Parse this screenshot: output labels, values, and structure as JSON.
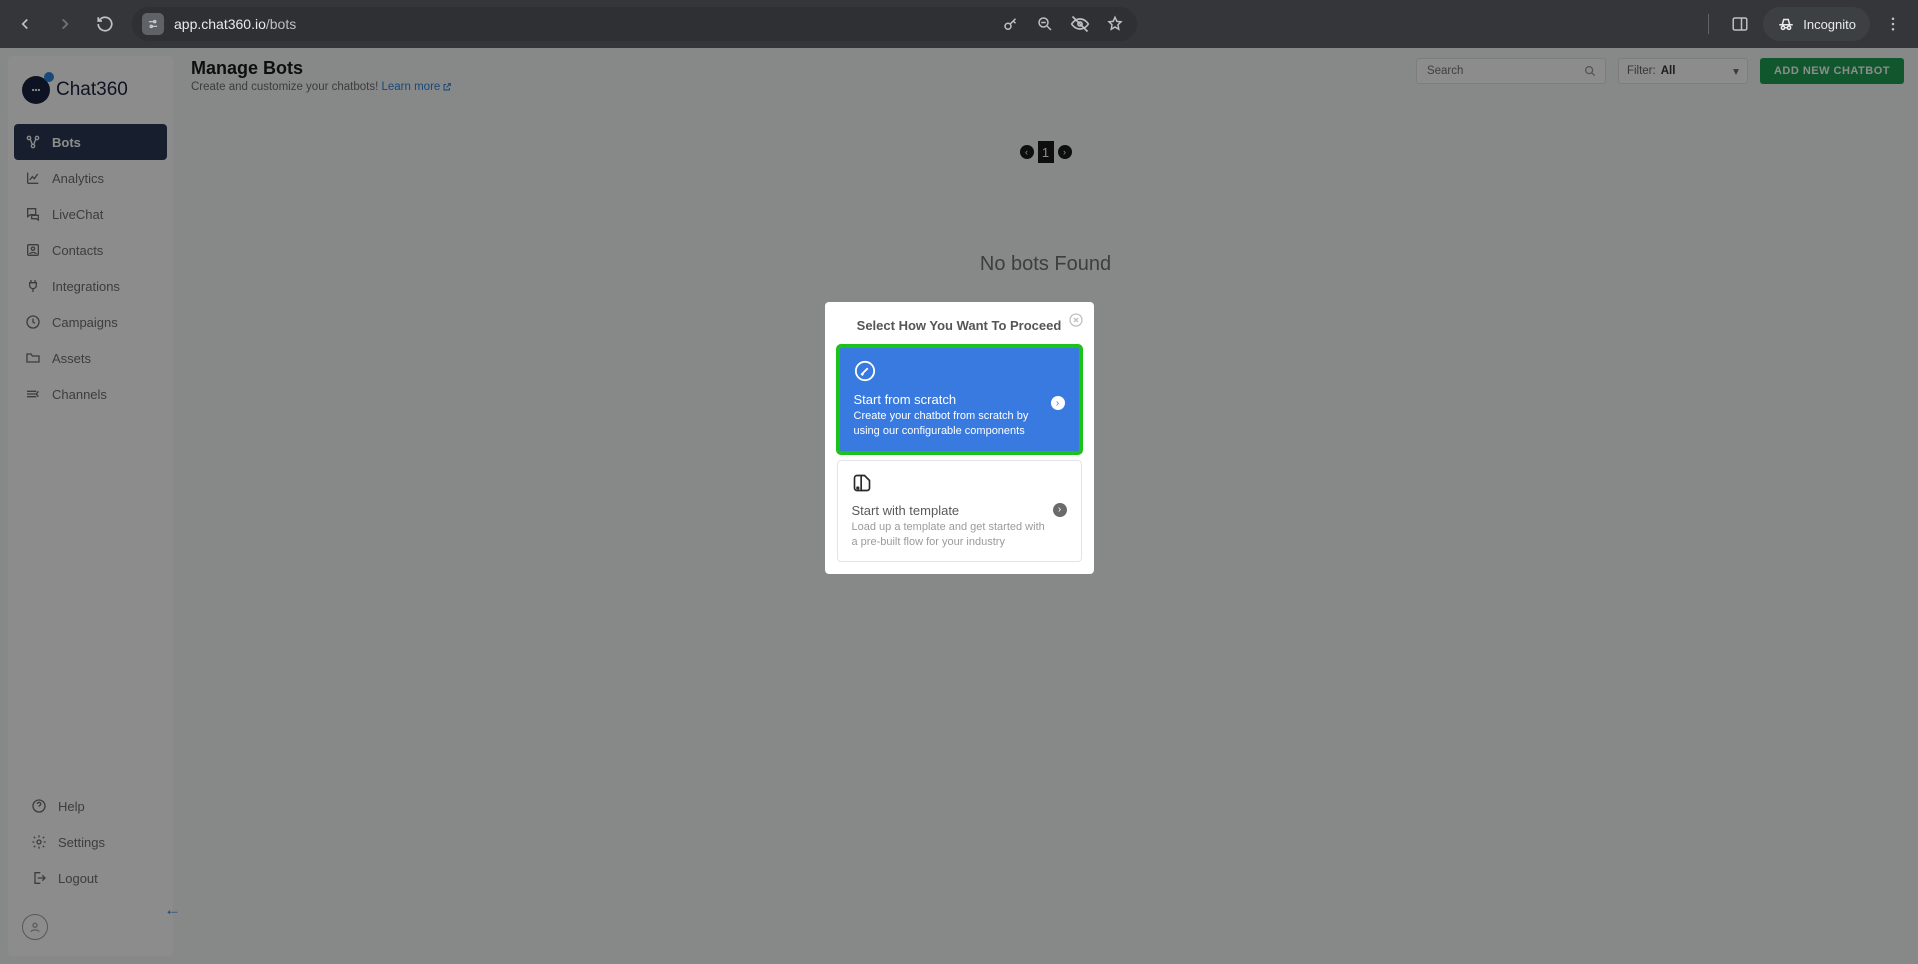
{
  "browser": {
    "url_host": "app.chat360.io",
    "url_path": "/bots",
    "incognito_label": "Incognito"
  },
  "logo_text": "Chat360",
  "sidebar": {
    "items": [
      {
        "label": "Bots",
        "icon": "bots-icon",
        "active": true
      },
      {
        "label": "Analytics",
        "icon": "chart-icon"
      },
      {
        "label": "LiveChat",
        "icon": "chat-icon"
      },
      {
        "label": "Contacts",
        "icon": "contacts-icon"
      },
      {
        "label": "Integrations",
        "icon": "plug-icon"
      },
      {
        "label": "Campaigns",
        "icon": "campaign-icon"
      },
      {
        "label": "Assets",
        "icon": "folder-icon"
      },
      {
        "label": "Channels",
        "icon": "channels-icon"
      }
    ],
    "bottom": [
      {
        "label": "Help",
        "icon": "help-icon"
      },
      {
        "label": "Settings",
        "icon": "gear-icon"
      },
      {
        "label": "Logout",
        "icon": "logout-icon"
      }
    ]
  },
  "header": {
    "title": "Manage Bots",
    "subtitle": "Create and customize your chatbots! ",
    "learn_more": "Learn more",
    "search_placeholder": "Search",
    "filter_label": "Filter:",
    "filter_value": "All",
    "add_button": "ADD NEW CHATBOT"
  },
  "pager": {
    "current": "1"
  },
  "empty_msg": "No bots Found",
  "modal": {
    "title": "Select How You Want To Proceed",
    "options": [
      {
        "title": "Start from scratch",
        "desc": "Create your chatbot from scratch by using our configurable components"
      },
      {
        "title": "Start with template",
        "desc": "Load up a template and get started with a pre-built flow for your industry"
      }
    ]
  }
}
